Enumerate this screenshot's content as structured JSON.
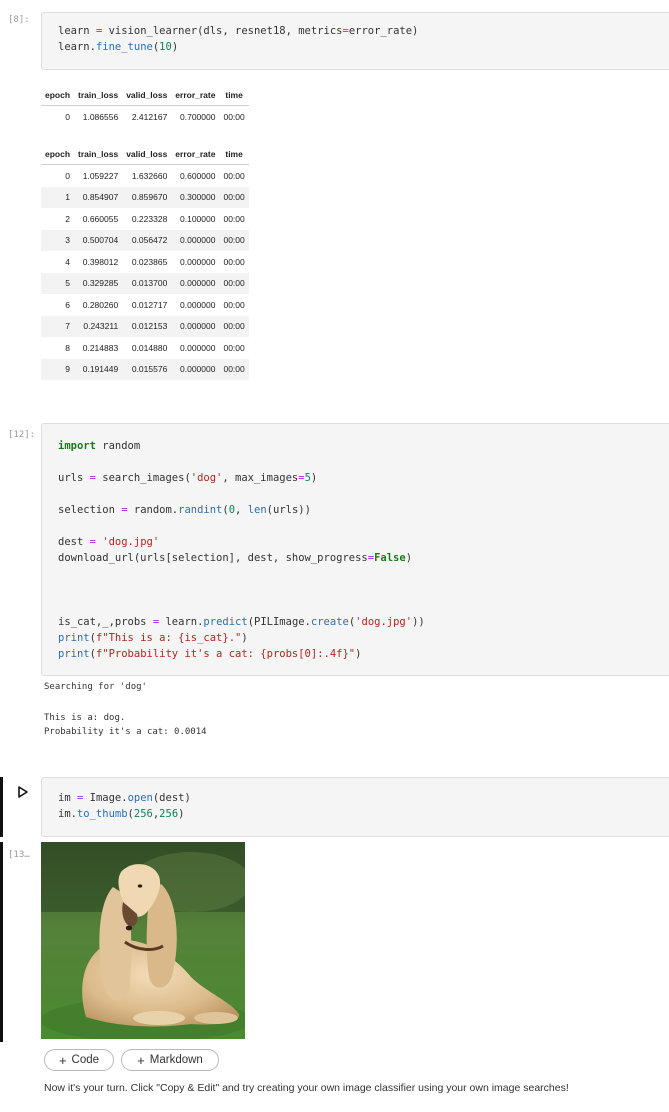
{
  "cell8": {
    "prompt": "[8]:",
    "code": [
      "learn = vision_learner(dls, resnet18, metrics=error_rate)",
      "learn.fine_tune(10)"
    ],
    "headers": [
      "epoch",
      "train_loss",
      "valid_loss",
      "error_rate",
      "time"
    ],
    "table1_rows": [
      [
        "0",
        "1.086556",
        "2.412167",
        "0.700000",
        "00:00"
      ]
    ],
    "table2_rows": [
      [
        "0",
        "1.059227",
        "1.632660",
        "0.600000",
        "00:00"
      ],
      [
        "1",
        "0.854907",
        "0.859670",
        "0.300000",
        "00:00"
      ],
      [
        "2",
        "0.660055",
        "0.223328",
        "0.100000",
        "00:00"
      ],
      [
        "3",
        "0.500704",
        "0.056472",
        "0.000000",
        "00:00"
      ],
      [
        "4",
        "0.398012",
        "0.023865",
        "0.000000",
        "00:00"
      ],
      [
        "5",
        "0.329285",
        "0.013700",
        "0.000000",
        "00:00"
      ],
      [
        "6",
        "0.280260",
        "0.012717",
        "0.000000",
        "00:00"
      ],
      [
        "7",
        "0.243211",
        "0.012153",
        "0.000000",
        "00:00"
      ],
      [
        "8",
        "0.214883",
        "0.014880",
        "0.000000",
        "00:00"
      ],
      [
        "9",
        "0.191449",
        "0.015576",
        "0.000000",
        "00:00"
      ]
    ]
  },
  "cell12": {
    "prompt": "[12]:",
    "code": [
      "import random",
      "urls = search_images('dog', max_images=5)",
      "selection = random.randint(0, len(urls))",
      "dest = 'dog.jpg'",
      "download_url(urls[selection], dest, show_progress=False)",
      "is_cat,_,probs = learn.predict(PILImage.create('dog.jpg'))",
      "print(f\"This is a: {is_cat}.\")",
      "print(f\"Probability it's a cat: {probs[0]:.4f}\")"
    ],
    "output": [
      "Searching for 'dog'",
      "This is a: dog.",
      "Probability it's a cat: 0.0014"
    ]
  },
  "cell13": {
    "prompt": "[13…",
    "code": [
      "im = Image.open(dest)",
      "im.to_thumb(256,256)"
    ],
    "run_icon": "play-icon",
    "image_icon": "dog-photo"
  },
  "add_buttons": {
    "code_label": "Code",
    "markdown_label": "Markdown",
    "icon": "plus-icon"
  },
  "footer_text": "Now it's your turn. Click \"Copy & Edit\" and try creating your own image classifier using your own image searches!"
}
